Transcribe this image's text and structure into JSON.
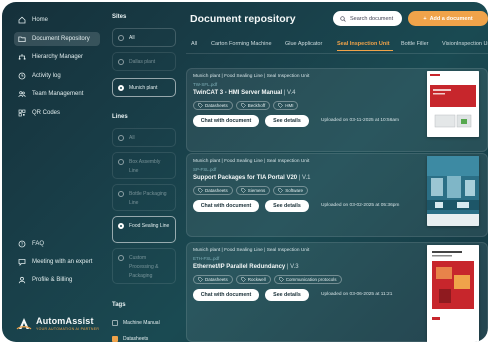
{
  "sidebar": {
    "nav": [
      {
        "label": "Home",
        "icon": "home-icon"
      },
      {
        "label": "Document Repository",
        "icon": "folder-icon"
      },
      {
        "label": "Hierarchy Manager",
        "icon": "hierarchy-icon"
      },
      {
        "label": "Activity log",
        "icon": "activity-icon"
      },
      {
        "label": "Team Management",
        "icon": "team-icon"
      },
      {
        "label": "QR Codes",
        "icon": "qr-icon"
      }
    ],
    "bottom": [
      {
        "label": "FAQ",
        "icon": "help-icon"
      },
      {
        "label": "Meeting with an expert",
        "icon": "chat-icon"
      },
      {
        "label": "Profile & Billing",
        "icon": "user-icon"
      }
    ],
    "brand_name": "AutomAssist",
    "brand_tagline": "YOUR AUTOMATION AI PARTNER"
  },
  "filters": {
    "sites_heading": "Sites",
    "sites": [
      {
        "label": "All",
        "selected": false
      },
      {
        "label": "Dallas plant",
        "selected": false
      },
      {
        "label": "Munich plant",
        "selected": true
      }
    ],
    "lines_heading": "Lines",
    "lines": [
      {
        "label": "All",
        "selected": false
      },
      {
        "label": "Box Assembly Line",
        "selected": false
      },
      {
        "label": "Bottle Packaging Line",
        "selected": false
      },
      {
        "label": "Food Sealing Line",
        "selected": true
      },
      {
        "label": "Custom Processing & Packaging",
        "selected": false
      }
    ],
    "tags_heading": "Tags",
    "tags": [
      {
        "label": "Machine Manual",
        "checked": false
      },
      {
        "label": "Datasheets",
        "checked": true
      }
    ]
  },
  "main": {
    "title": "Document repository",
    "search_placeholder": "Search document",
    "add_label": "Add a document",
    "tabs": [
      "All",
      "Carton Forming Machine",
      "Glue Applicator",
      "Seal Inspection Unit",
      "Bottle Filler",
      "VisionInspection Uni"
    ],
    "active_tab": 3,
    "documents": [
      {
        "breadcrumb": "Munich plant | Food Sealing Line | Seal Inspection Unit",
        "file": "TW-SFL.pdf",
        "title": "TwinCAT 3 - HMI Server Manual",
        "version": " | V.4",
        "tags": [
          "Datasheets",
          "Beckhoff",
          "HMI"
        ],
        "chat_label": "Chat with document",
        "details_label": "See details",
        "uploaded": "Uploaded on 03-11-2025 at 10:56am"
      },
      {
        "breadcrumb": "Munich plant | Food Sealing Line | Seal Inspection Unit",
        "file": "SP-FSL.pdf",
        "title": "Support Packages for TIA Portal V20",
        "version": " | V.1",
        "tags": [
          "Datasheets",
          "Siemens",
          "Software"
        ],
        "chat_label": "Chat with document",
        "details_label": "See details",
        "uploaded": "Uploaded on 03-02-2025 at 05:36pm"
      },
      {
        "breadcrumb": "Munich plant | Food Sealing Line | Seal Inspection Unit",
        "file": "ETH-FSL.pdf",
        "title": "Ethernet/IP Parallel Redundancy",
        "version": " | V.3",
        "tags": [
          "Datasheets",
          "Rockwell",
          "Communication protocols"
        ],
        "chat_label": "Chat with document",
        "details_label": "See details",
        "uploaded": "Uploaded on 03-06-2025 at 11:21"
      }
    ]
  },
  "colors": {
    "accent": "#f0a34a",
    "bg": "#1a4a52"
  }
}
